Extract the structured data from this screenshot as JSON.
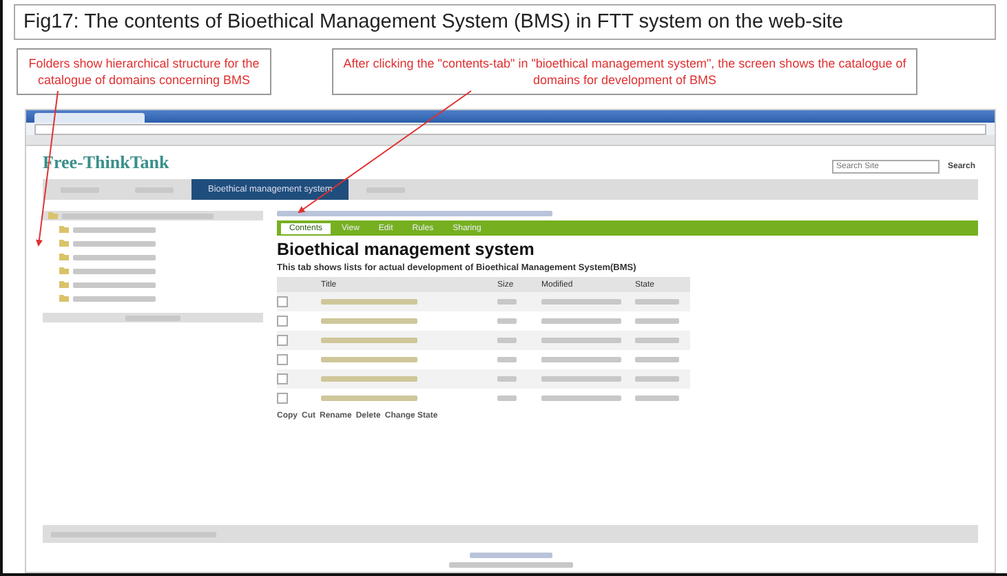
{
  "figure": {
    "title": "Fig17: The contents of Bioethical Management System (BMS) in FTT system on the web-site",
    "callouts": [
      {
        "text": "Folders show hierarchical structure for the catalogue of domains concerning BMS"
      },
      {
        "text": "After clicking the \"contents-tab\" in \"bioethical management system\", the screen shows the catalogue of domains for development of BMS"
      }
    ]
  },
  "site": {
    "logo": "Free-ThinkTank",
    "search": {
      "placeholder": "Search Site",
      "button": "Search"
    },
    "nav": [
      {
        "selected": false
      },
      {
        "selected": false
      },
      {
        "selected": true,
        "label": "Bioethical management system"
      },
      {
        "selected": false
      }
    ],
    "sidebar": {
      "items": [
        {
          "selected": true
        },
        {
          "selected": false
        },
        {
          "selected": false
        },
        {
          "selected": false
        },
        {
          "selected": false
        },
        {
          "selected": false
        },
        {
          "selected": false
        }
      ]
    },
    "content_tabs": [
      {
        "label": "Contents",
        "selected": true
      },
      {
        "label": "View",
        "selected": false
      },
      {
        "label": "Edit",
        "selected": false
      },
      {
        "label": "Rules",
        "selected": false
      },
      {
        "label": "Sharing",
        "selected": false
      }
    ],
    "heading": "Bioethical management system",
    "description": "This tab shows lists for actual development of Bioethical Management System(BMS)",
    "table": {
      "columns": [
        "Title",
        "Size",
        "Modified",
        "State"
      ],
      "rows": [
        {
          "checked": false
        },
        {
          "checked": false
        },
        {
          "checked": false
        },
        {
          "checked": false
        },
        {
          "checked": false
        },
        {
          "checked": false
        }
      ]
    },
    "actions": [
      "Copy",
      "Cut",
      "Rename",
      "Delete",
      "Change State"
    ]
  }
}
